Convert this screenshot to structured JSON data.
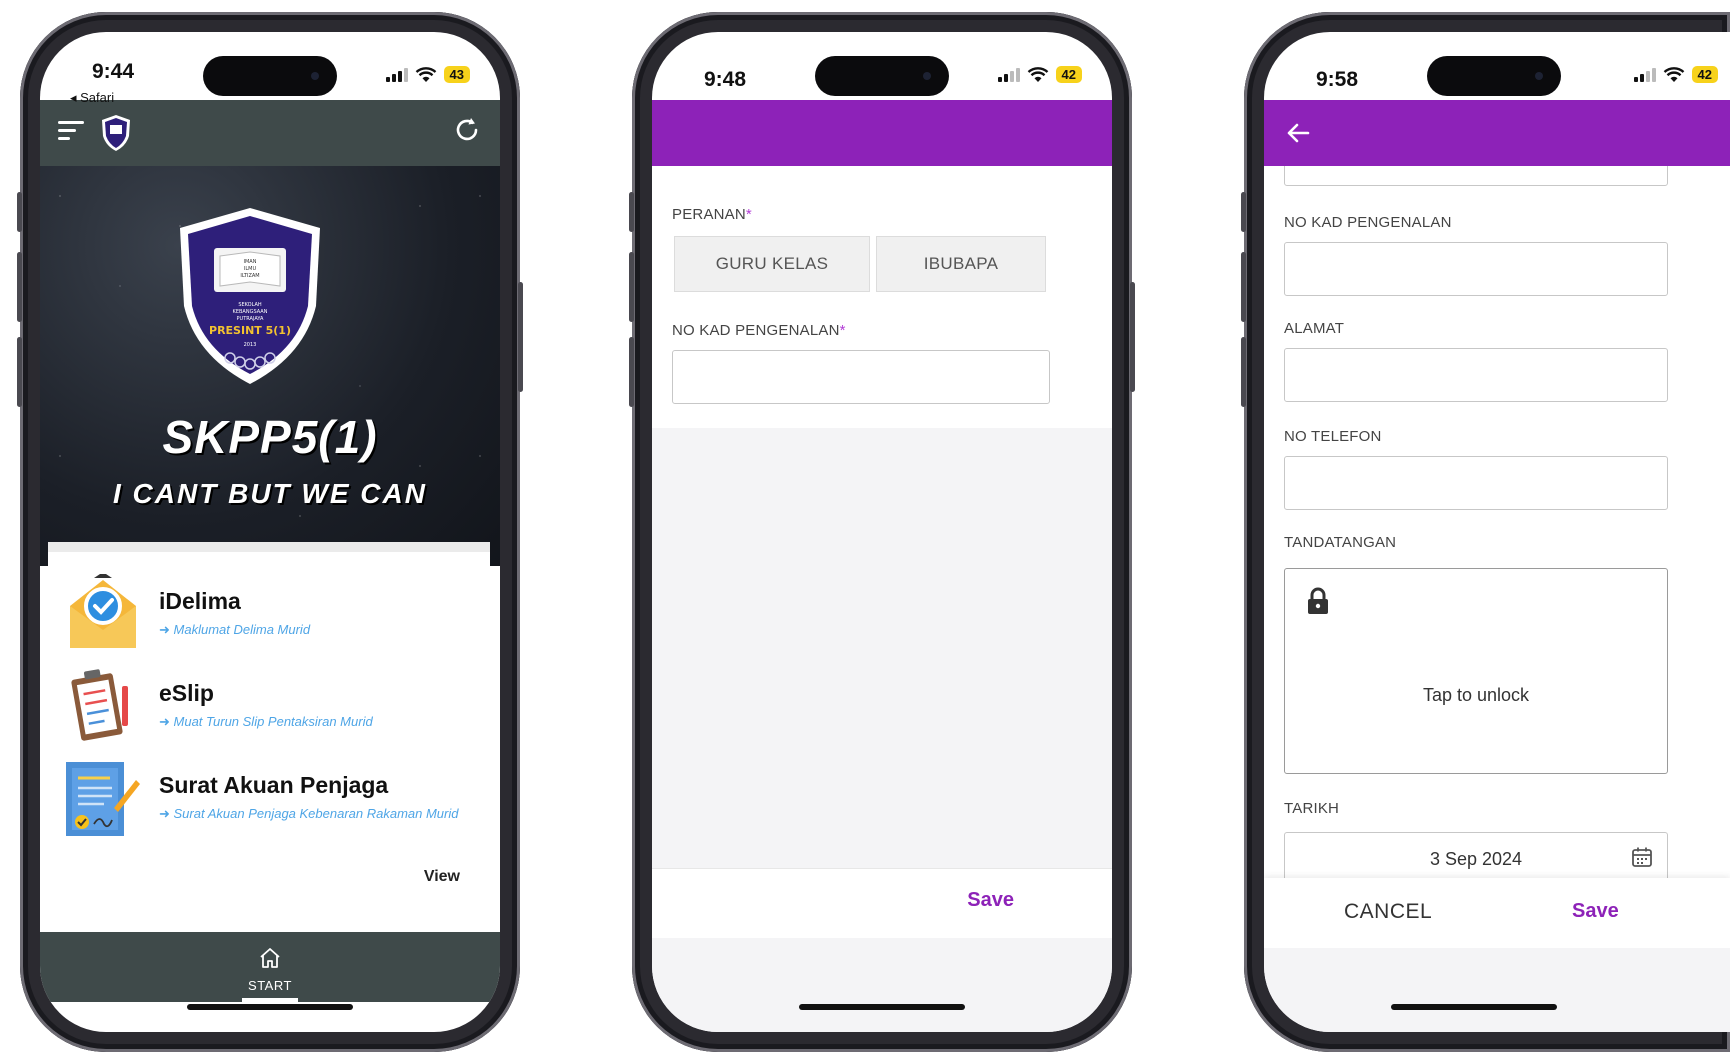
{
  "phone1": {
    "status": {
      "time": "9:44",
      "back_app": "◂ Safari",
      "battery": "43"
    },
    "brand": "SKPP5(1)",
    "tagline": "I CANT BUT WE CAN",
    "shield": {
      "line1": "IMAN",
      "line2": "ILMU",
      "line3": "ILTIZAM",
      "school1": "SEKOLAH",
      "school2": "KEBANGSAAN",
      "school3": "PUTRAJAYA",
      "name": "PRESINT 5(1)",
      "year": "2013"
    },
    "menu": [
      {
        "title": "iDelima",
        "subtitle": "Maklumat Delima Murid"
      },
      {
        "title": "eSlip",
        "subtitle": "Muat Turun Slip Pentaksiran Murid"
      },
      {
        "title": "Surat Akuan Penjaga",
        "subtitle": "Surat Akuan Penjaga Kebenaran Rakaman Murid"
      }
    ],
    "view_label": "View",
    "nav": {
      "start_label": "START"
    },
    "colors": {
      "appbar": "#3f4a4a",
      "accent_link": "#4ea5e6",
      "shield": "#2e1f7a"
    }
  },
  "phone2": {
    "status": {
      "time": "9:48",
      "battery": "42"
    },
    "peranan_label": "PERANAN",
    "required_mark": "*",
    "roles": [
      "GURU KELAS",
      "IBUBAPA"
    ],
    "nokp_label": "NO KAD PENGENALAN",
    "save_label": "Save",
    "colors": {
      "primary": "#8d22b8"
    }
  },
  "phone3": {
    "status": {
      "time": "9:58",
      "battery": "42"
    },
    "fields": {
      "nokp_label": "NO KAD PENGENALAN",
      "alamat_label": "ALAMAT",
      "telefon_label": "NO TELEFON",
      "tandatangan_label": "TANDATANGAN",
      "tarikh_label": "TARIKH"
    },
    "unlock_text": "Tap to unlock",
    "date_value": "3 Sep 2024",
    "cancel_label": "CANCEL",
    "save_label": "Save",
    "icons": {
      "back": "arrow-left-icon",
      "lock": "lock-icon",
      "calendar": "calendar-icon"
    }
  }
}
